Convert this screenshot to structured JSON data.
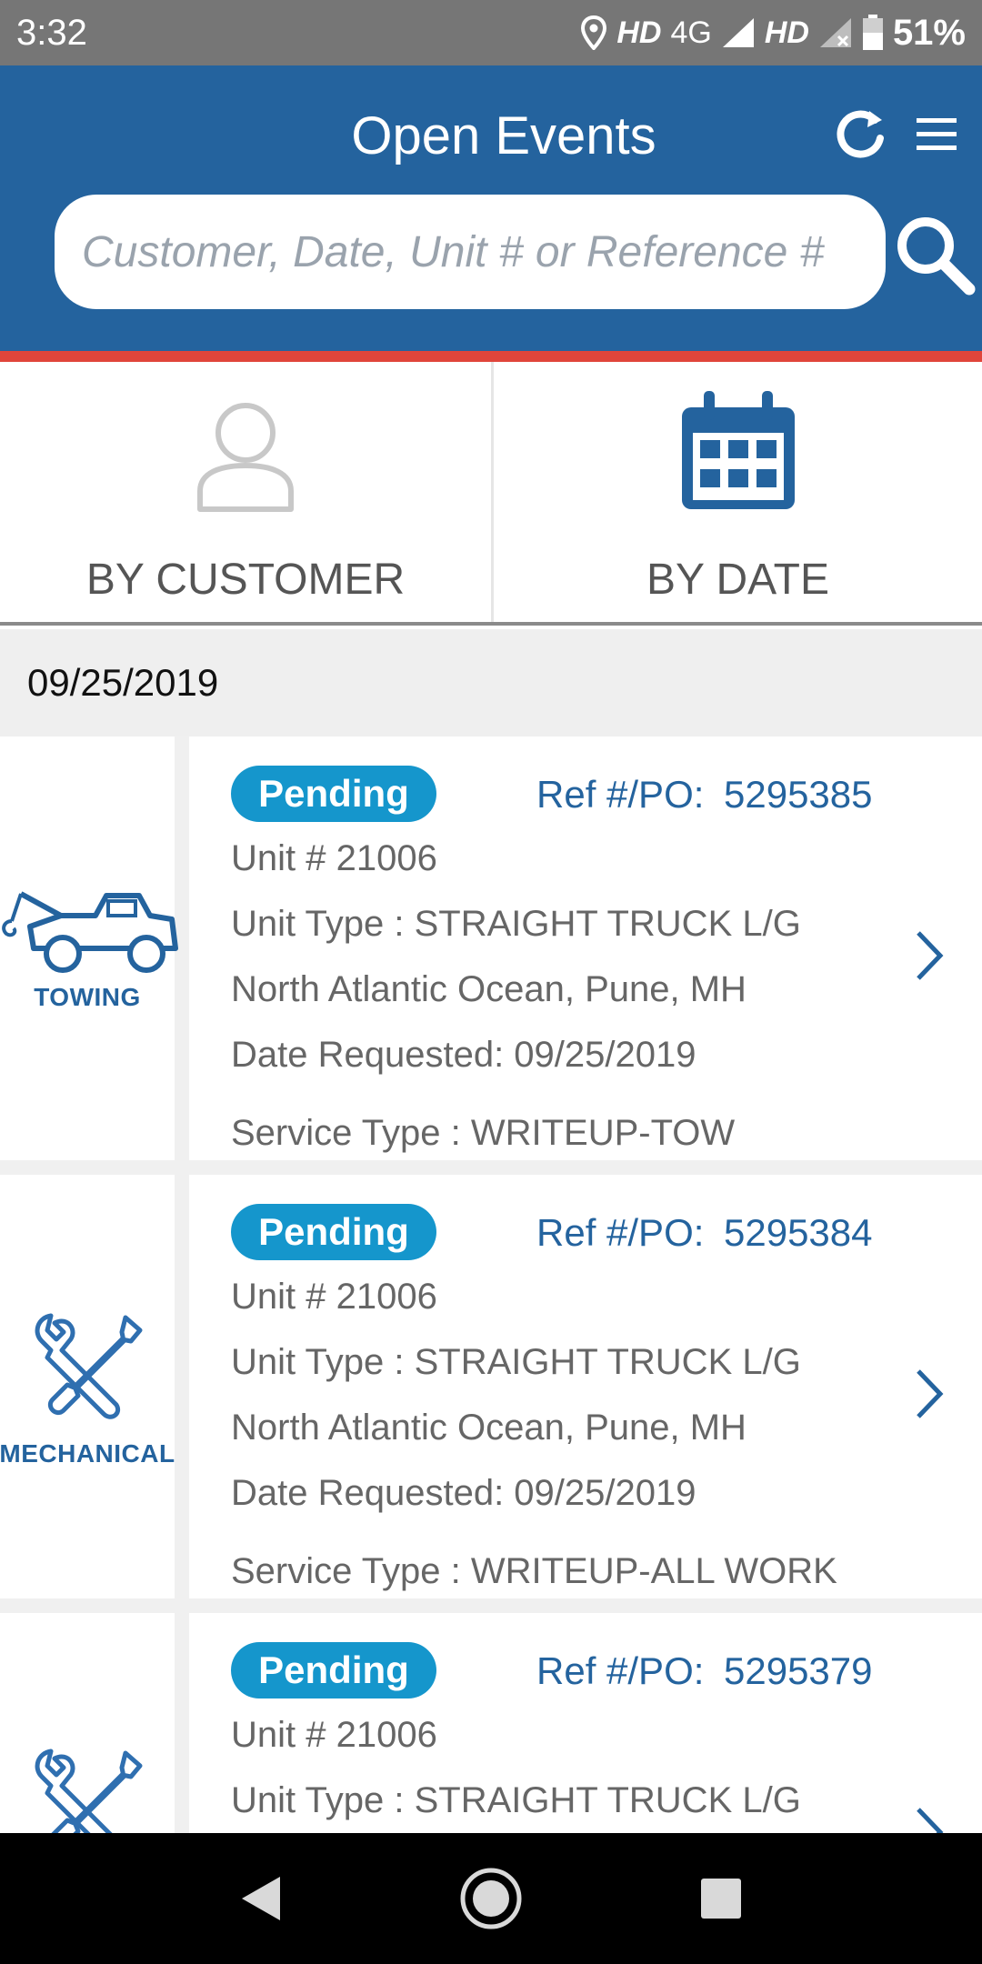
{
  "status_bar": {
    "time": "3:32",
    "network_hd1": "HD",
    "network_4g": "4G",
    "network_hd2": "HD",
    "battery": "51%"
  },
  "header": {
    "title": "Open Events",
    "search_placeholder": "Customer, Date, Unit # or Reference #",
    "refresh_icon": "refresh-icon",
    "menu_icon": "hamburger-menu-icon",
    "search_icon": "search-icon"
  },
  "filters": {
    "by_customer": "BY CUSTOMER",
    "by_date": "BY DATE"
  },
  "date_group": "09/25/2019",
  "events": [
    {
      "category": "TOWING",
      "status": "Pending",
      "ref_label": "Ref #/PO:",
      "ref_value": "5295385",
      "unit": "Unit # 21006",
      "unit_type": "Unit Type : STRAIGHT TRUCK L/G",
      "location": "North Atlantic Ocean, Pune, MH",
      "date_requested": "Date Requested:  09/25/2019",
      "service_type": "Service Type : WRITEUP-TOW"
    },
    {
      "category": "MECHANICAL",
      "status": "Pending",
      "ref_label": "Ref #/PO:",
      "ref_value": "5295384",
      "unit": "Unit # 21006",
      "unit_type": "Unit Type : STRAIGHT TRUCK L/G",
      "location": "North Atlantic Ocean, Pune, MH",
      "date_requested": "Date Requested:  09/25/2019",
      "service_type": "Service Type : WRITEUP-ALL WORK"
    },
    {
      "category": "MECHANICAL",
      "status": "Pending",
      "ref_label": "Ref #/PO:",
      "ref_value": "5295379",
      "unit": "Unit # 21006",
      "unit_type": "Unit Type : STRAIGHT TRUCK L/G"
    }
  ],
  "colors": {
    "header_blue": "#24639e",
    "accent_red": "#e0453b",
    "badge_blue": "#1596cc"
  }
}
